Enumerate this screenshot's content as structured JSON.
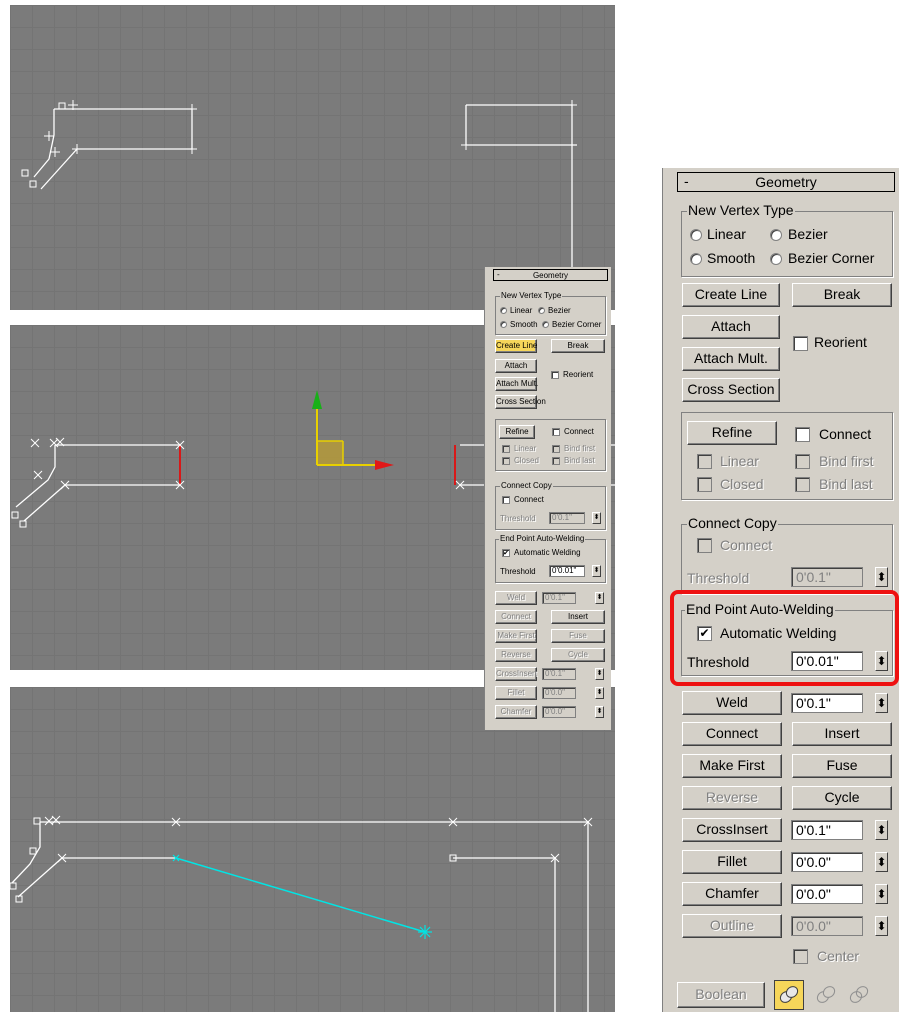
{
  "geometry_panel": {
    "title": "Geometry",
    "collapse_symbol": "-",
    "new_vertex_type": {
      "label": "New Vertex Type",
      "linear": "Linear",
      "bezier": "Bezier",
      "smooth": "Smooth",
      "bezier_corner": "Bezier Corner",
      "selected": "Linear"
    },
    "buttons": {
      "create_line": "Create Line",
      "break": "Break",
      "attach": "Attach",
      "attach_mult": "Attach Mult.",
      "cross_section": "Cross Section",
      "refine": "Refine",
      "weld": "Weld",
      "connect": "Connect",
      "insert": "Insert",
      "make_first": "Make First",
      "fuse": "Fuse",
      "reverse": "Reverse",
      "cycle": "Cycle",
      "crossinsert": "CrossInsert",
      "fillet": "Fillet",
      "chamfer": "Chamfer",
      "outline": "Outline",
      "boolean": "Boolean"
    },
    "checks": {
      "reorient": "Reorient",
      "connect": "Connect",
      "linear": "Linear",
      "bind_first": "Bind first",
      "closed": "Closed",
      "bind_last": "Bind last",
      "center": "Center"
    },
    "connect_copy": {
      "label": "Connect Copy",
      "connect": "Connect",
      "threshold_label": "Threshold",
      "threshold_value": "0'0.1\""
    },
    "auto_weld": {
      "label": "End Point Auto-Welding",
      "checkbox_label": "Automatic Welding",
      "checked": true,
      "threshold_label": "Threshold",
      "threshold_value": "0'0.01\""
    },
    "values": {
      "weld": "0'0.1\"",
      "crossinsert": "0'0.1\"",
      "fillet": "0'0.0\"",
      "chamfer": "0'0.0\"",
      "outline": "0'0.0\""
    },
    "check_mark": "✔",
    "spinner_glyph": "⬍"
  },
  "colors": {
    "highlight": "#ee1111",
    "active_button": "#f6d65a",
    "panel_bg": "#d4d0c8",
    "viewport_bg": "#7b7b7b",
    "selected_segment": "#00e5e5"
  }
}
